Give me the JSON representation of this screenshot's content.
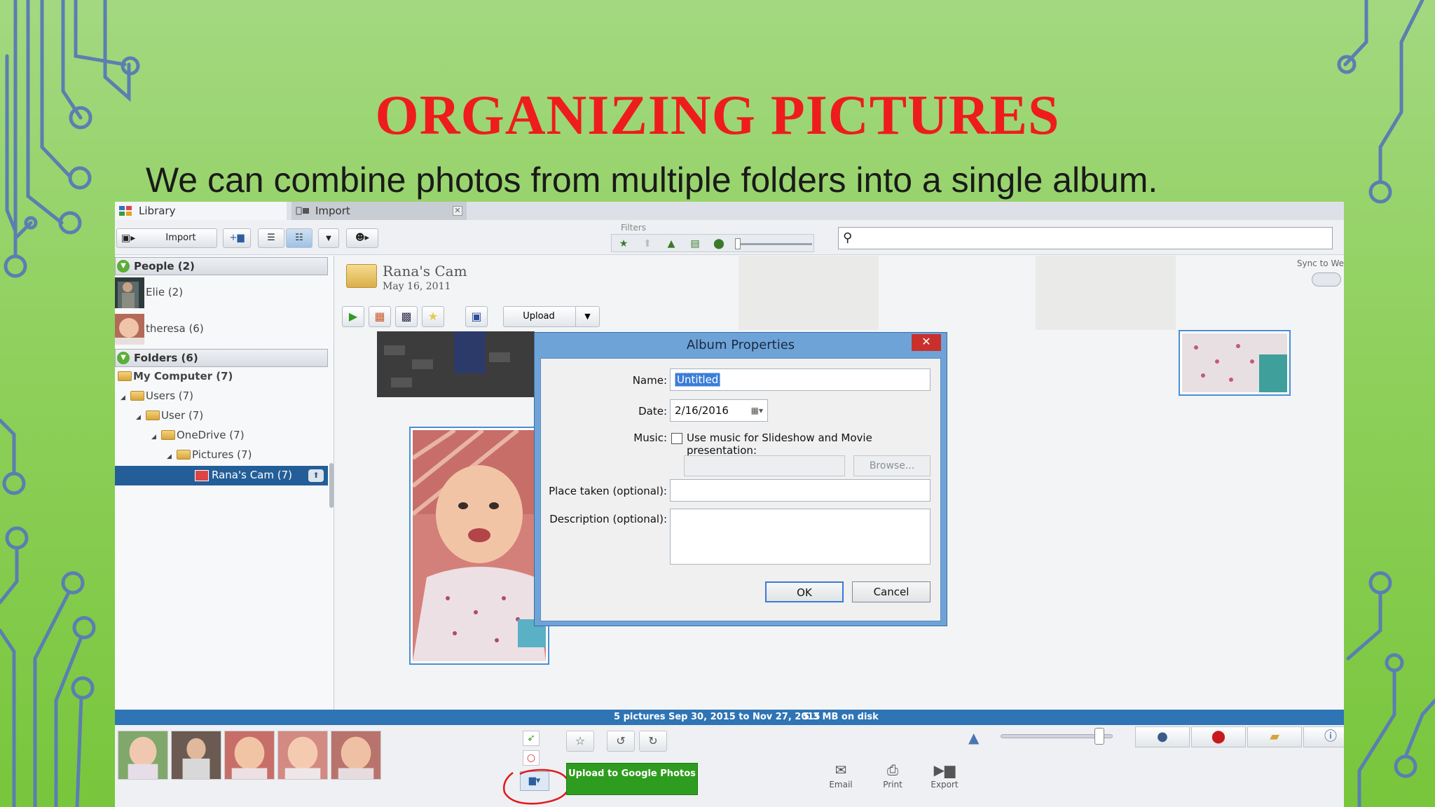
{
  "slide": {
    "title": "ORGANIZING PICTURES",
    "subtitle": "We can combine photos from multiple folders into a single album."
  },
  "app": {
    "tabs": [
      {
        "label": "Library",
        "active": true
      },
      {
        "label": "Import",
        "active": false
      }
    ],
    "toolbar": {
      "import_label": "Import",
      "filters_label": "Filters",
      "search_value": ""
    },
    "sidebar": {
      "people_header": "People (2)",
      "people": [
        {
          "name": "Elie (2)"
        },
        {
          "name": "theresa (6)"
        }
      ],
      "folders_header": "Folders (6)",
      "tree": [
        {
          "label": "My Computer (7)",
          "bold": true
        },
        {
          "label": "Users (7)"
        },
        {
          "label": "User (7)"
        },
        {
          "label": "OneDrive (7)"
        },
        {
          "label": "Pictures (7)"
        }
      ],
      "selected": "Rana's Cam (7)"
    },
    "album": {
      "title": "Rana's Cam",
      "date": "May 16, 2011",
      "upload_label": "Upload",
      "sync_label": "Sync to We"
    },
    "dialog": {
      "title": "Album Properties",
      "name_label": "Name:",
      "name_value": "Untitled",
      "date_label": "Date:",
      "date_value": "2/16/2016",
      "music_label": "Music:",
      "music_checkbox_label": "Use music for Slideshow and Movie presentation:",
      "music_checked": false,
      "browse_label": "Browse...",
      "place_label": "Place taken (optional):",
      "place_value": "",
      "description_label": "Description (optional):",
      "description_value": "",
      "ok_label": "OK",
      "cancel_label": "Cancel"
    },
    "status": {
      "count": "5 pictures",
      "range": "Sep 30, 2015 to Nov 27, 2015",
      "size": "5.3 MB on disk"
    },
    "bottom": {
      "google_upload_label": "Upload to Google Photos",
      "actions": [
        {
          "label": "Email",
          "icon": "envelope-icon"
        },
        {
          "label": "Print",
          "icon": "printer-icon"
        },
        {
          "label": "Export",
          "icon": "export-icon"
        }
      ]
    },
    "colors": {
      "title_red": "#ee1c1c",
      "selection_blue": "#235e98",
      "status_blue": "#2f74b5",
      "google_green": "#2e9c1e",
      "annotation_circle": "#e0191b"
    }
  }
}
